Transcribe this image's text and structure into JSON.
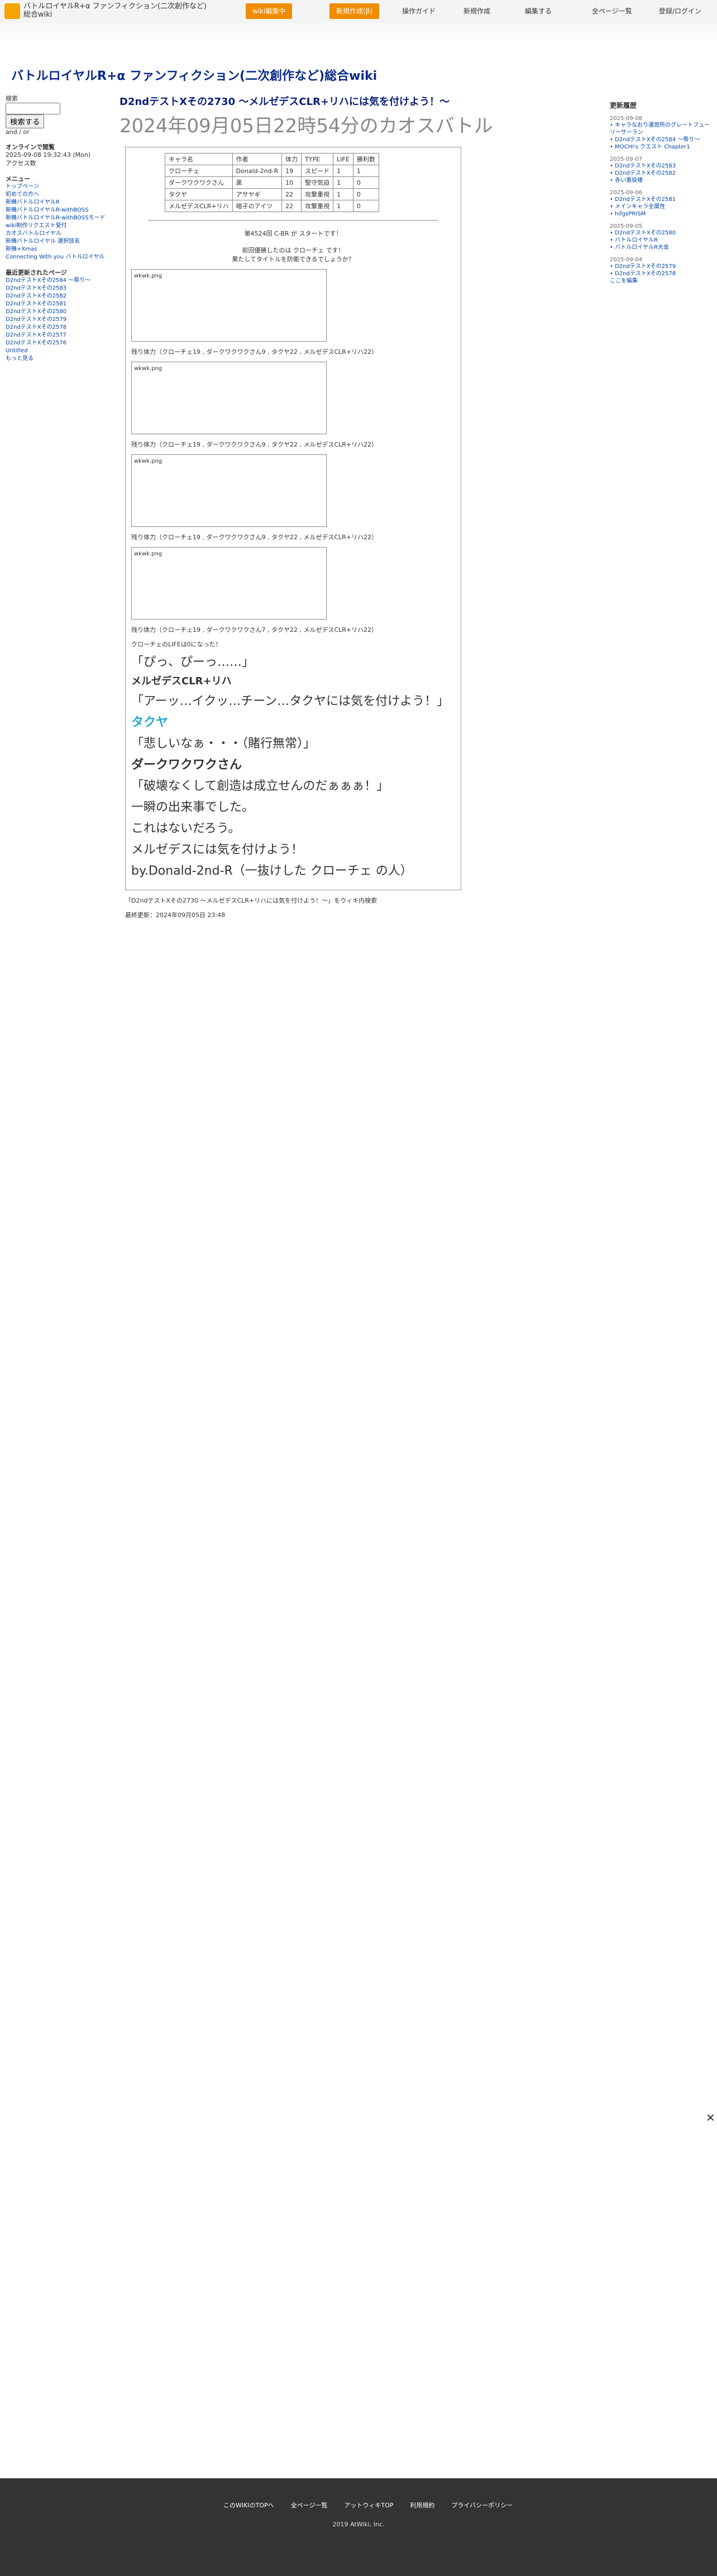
{
  "header": {
    "site_name": "バトルロイヤルR+α ファンフィクション(二次創作など)総合wiki",
    "wiki_menu": "wiki編集中",
    "new_page": "新規作成(β)",
    "guide": "操作ガイド",
    "create": "新規作成",
    "edit": "編集する",
    "all_pages": "全ページ一覧",
    "login": "登録/ログイン"
  },
  "wiki_title": "バトルロイヤルR+α ファンフィクション(二次創作など)総合wiki",
  "sidebar": {
    "search_label": "検索",
    "search_button": "検索する",
    "and_or": "and / or",
    "online_label": "オンラインで閲覧",
    "date": "2025-09-08 19:32:43 (Mon)",
    "access_label": "アクセス数",
    "menu_title": "メニュー",
    "menu": [
      "トップページ",
      "初めての方へ",
      "新機バトルロイヤルR",
      "新機バトルロイヤルR-withBOSS",
      "新機バトルロイヤルR-withBOSSモード",
      "wiki制作リクエスト受付",
      "カオスバトルロイヤル",
      "新機バトルロイヤル 選択技名",
      "新機+Xmas",
      "Connecting With you バトルロイヤル"
    ],
    "recent_title": "最近更新されたページ",
    "recent": [
      "D2ndテストXその2584 ～祭り～",
      "D2ndテストXその2583",
      "D2ndテストXその2582",
      "D2ndテストXその2581",
      "D2ndテストXその2580",
      "D2ndテストXその2579",
      "D2ndテストXその2578",
      "D2ndテストXその2577",
      "D2ndテストXその2576",
      "Untitled"
    ],
    "more": "もっと見る"
  },
  "page": {
    "title": "D2ndテストXその2730 ～メルゼデスCLR+リハには気を付けよう！～",
    "subtitle": "2024年09月05日22時54分のカオスバトル",
    "table_headers": [
      "キャラ名",
      "作者",
      "体力",
      "TYPE",
      "LIFE",
      "勝利数"
    ],
    "table_rows": [
      [
        "クローチェ",
        "Donald-2nd-R",
        "19",
        "スピード",
        "1",
        "1"
      ],
      [
        "ダークワクワクさん",
        "黒",
        "10",
        "堅守気迫",
        "1",
        "0"
      ],
      [
        "タクヤ",
        "アサヤギ",
        "22",
        "攻撃重視",
        "1",
        "0"
      ],
      [
        "メルゼデスCLR+リハ",
        "暗子のアイツ",
        "22",
        "攻撃重視",
        "1",
        "0"
      ]
    ],
    "start": "第4524回 C-BR が スタートです！",
    "prev_winner": "前回優勝したのは クローチェ です！",
    "prev_note": "果たしてタイトルを防衛できるでしょうか？",
    "image_placeholder": "wkwk.png",
    "lines": [
      "残り体力（クローチェ19 , ダークワクワクさん9 , タクヤ22 , メルゼデスCLR+リハ22）",
      "残り体力（クローチェ19 , ダークワクワクさん9 , タクヤ22 , メルゼデスCLR+リハ22）",
      "残り体力（クローチェ19 , ダークワクワクさん9 , タクヤ22 , メルゼデスCLR+リハ22）",
      "残り体力（クローチェ19 , ダークワクワクさん7 , タクヤ22 , メルゼデスCLR+リハ22）"
    ],
    "faint": "クローチェのLIFEは0になった！",
    "faint_quote": "「ぴっ、ぴーっ……」",
    "big1": "メルゼデスCLR+リハ",
    "big1_quote": "「アーッ…イクッ…チーン…タクヤには気を付けよう！」",
    "takuya": "タクヤ",
    "takuya_quote": "「悲しいなぁ・・・（賭行無常）」",
    "winner_name": "ダークワクワクさん",
    "winner_quote": "「破壊なくして創造は成立せんのだぁぁぁ！」",
    "ending": [
      "一瞬の出来事でした。",
      "これはないだろう。",
      "メルゼデスには気を付けよう！",
      "by.Donald-2nd-R（一抜けした クローチェ の人）"
    ],
    "share": "「D2ndテストXその2730 ～メルゼデスCLR+リハには気を付けよう！～」をウィキ内検索",
    "updated": "最終更新：2024年09月05日 23:48"
  },
  "rightbar": {
    "title": "更新履歴",
    "dates": [
      "2025-09-08",
      "2025-09-07",
      "2025-09-06",
      "2025-09-05",
      "2025-09-04"
    ],
    "items": [
      "キャラなおり運営所のグレートフューリーサーラン",
      "D2ndテストXその2584 ～祭り～",
      "MOCHI's クエスト Chapter1",
      "D2ndテストXその2583",
      "D2ndテストXその2582",
      "赤い悪役様",
      "D2ndテストXその2581",
      "メインキャラ全属性",
      "hifgsPRISM",
      "D2ndテストXその2580",
      "バトルロイヤルR",
      "バトルロイヤルR大会",
      "D2ndテストXその2579",
      "D2ndテストXその2578"
    ],
    "link": "ここを編集"
  },
  "footer": {
    "links": [
      "このWIKIのTOPへ",
      "全ページ一覧",
      "アットウィキTOP",
      "利用規約",
      "プライバシーポリシー"
    ],
    "copyright": "2019 AtWiki, Inc."
  }
}
